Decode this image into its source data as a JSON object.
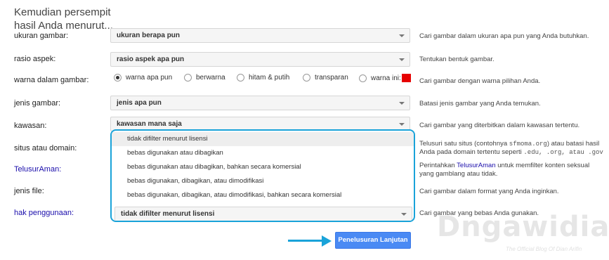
{
  "heading": "Kemudian persempit hasil Anda menurut...",
  "rows": [
    {
      "label": "ukuran gambar:",
      "value": "ukuran berapa pun",
      "help": "Cari gambar dalam ukuran apa pun yang Anda butuhkan."
    },
    {
      "label": "rasio aspek:",
      "value": "rasio aspek apa pun",
      "help": "Tentukan bentuk gambar."
    },
    {
      "label": "warna dalam gambar:",
      "help": "Cari gambar dengan warna pilihan Anda."
    },
    {
      "label": "jenis gambar:",
      "value": "jenis apa pun",
      "help": "Batasi jenis gambar yang Anda temukan."
    },
    {
      "label": "kawasan:",
      "value": "kawasan mana saja",
      "help": "Cari gambar yang diterbitkan dalam kawasan tertentu."
    },
    {
      "label": "situs atau domain:",
      "help_a": "Telusuri satu situs (contohnya",
      "help_code1": "sfmoma.org",
      "help_b": ") atau batasi hasil Anda pada domain tertentu seperti",
      "help_code2": ".edu, .org, atau .gov"
    },
    {
      "label": "TelusurAman:",
      "help_a": "Perintahkan",
      "help_link": "TelusurAman",
      "help_b": "untuk memfilter konten seksual yang gamblang atau tidak."
    },
    {
      "label": "jenis file:",
      "help": "Cari gambar dalam format yang Anda inginkan."
    },
    {
      "label": "hak penggunaan:",
      "value": "tidak difilter menurut lisensi",
      "help": "Cari gambar yang bebas Anda gunakan."
    }
  ],
  "colors": {
    "options": [
      "warna apa pun",
      "berwarna",
      "hitam & putih",
      "transparan",
      "warna ini:"
    ],
    "selected_index": 0,
    "swatch": "#e60000"
  },
  "dropdown_options": [
    "tidak difilter menurut lisensi",
    "bebas digunakan atau dibagikan",
    "bebas digunakan atau dibagikan, bahkan secara komersial",
    "bebas digunakan, dibagikan, atau dimodifikasi",
    "bebas digunakan, dibagikan, atau dimodifikasi, bahkan secara komersial"
  ],
  "button_label": "Penelusuran Lanjutan",
  "watermark": "Dngawidian",
  "watermark_sub": "The Official Blog Of Dian Arifin",
  "accent": "#1aa3d9",
  "button_color": "#4a8af4"
}
